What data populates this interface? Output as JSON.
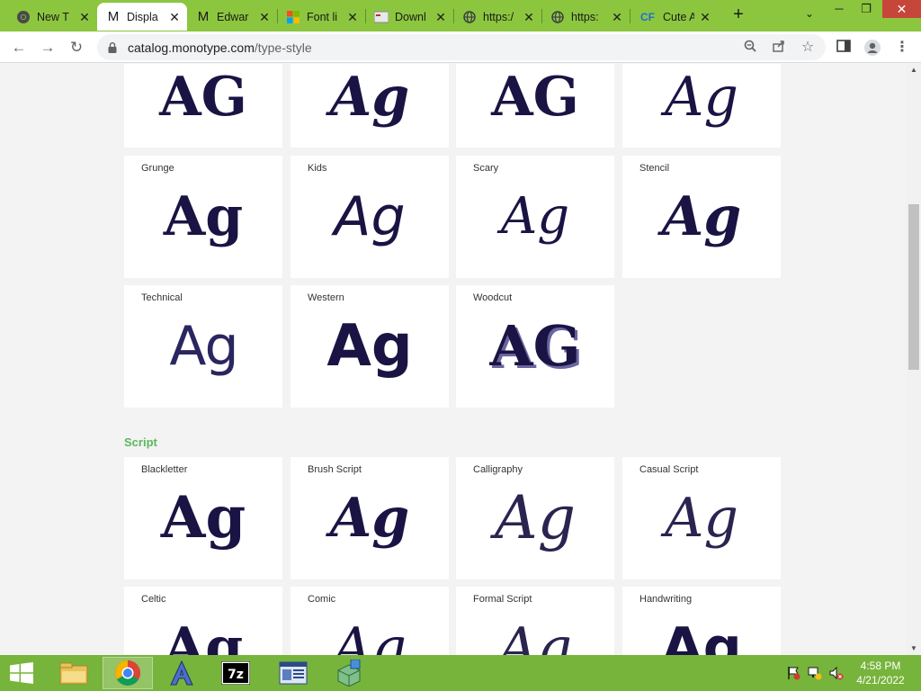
{
  "browser": {
    "tabs": [
      {
        "title": "New T",
        "icon": "chrome-icon",
        "active": false
      },
      {
        "title": "Displa",
        "icon": "monotype-m-icon",
        "active": true
      },
      {
        "title": "Edwar",
        "icon": "monotype-m-icon",
        "active": false
      },
      {
        "title": "Font li",
        "icon": "microsoft-icon",
        "active": false
      },
      {
        "title": "Downl",
        "icon": "download-site-icon",
        "active": false
      },
      {
        "title": "https:/",
        "icon": "globe-icon",
        "active": false
      },
      {
        "title": "https:",
        "icon": "globe-icon",
        "active": false
      },
      {
        "title": "Cute A",
        "icon": "cf-icon",
        "active": false
      }
    ],
    "new_tab_label": "+",
    "url_host": "catalog.monotype.com",
    "url_path": "/type-style"
  },
  "page": {
    "top_row": [
      {
        "sample": "AG"
      },
      {
        "sample": "Ag"
      },
      {
        "sample": "AG"
      },
      {
        "sample": "Ag"
      }
    ],
    "display_cards": [
      {
        "label": "Grunge",
        "sample": "Ag"
      },
      {
        "label": "Kids",
        "sample": "Ag"
      },
      {
        "label": "Scary",
        "sample": "Ag"
      },
      {
        "label": "Stencil",
        "sample": "Ag"
      },
      {
        "label": "Technical",
        "sample": "Ag"
      },
      {
        "label": "Western",
        "sample": "Ag"
      },
      {
        "label": "Woodcut",
        "sample": "AG"
      }
    ],
    "script_section_title": "Script",
    "script_cards": [
      {
        "label": "Blackletter",
        "sample": "Ag"
      },
      {
        "label": "Brush Script",
        "sample": "Ag"
      },
      {
        "label": "Calligraphy",
        "sample": "Ag"
      },
      {
        "label": "Casual Script",
        "sample": "Ag"
      },
      {
        "label": "Celtic",
        "sample": "Ag"
      },
      {
        "label": "Comic",
        "sample": "Ag"
      },
      {
        "label": "Formal Script",
        "sample": "Ag"
      },
      {
        "label": "Handwriting",
        "sample": "Ag"
      }
    ]
  },
  "taskbar": {
    "clock_time": "4:58 PM",
    "clock_date": "4/21/2022",
    "apps": [
      "start-icon",
      "file-explorer-icon",
      "chrome-icon",
      "font-app-icon",
      "7zip-icon",
      "document-viewer-icon",
      "package-installer-icon"
    ]
  },
  "colors": {
    "chrome_green": "#8cc63f",
    "taskbar_green": "#77b43b",
    "sample_ink": "#1a1444",
    "section_green": "#5bb85c"
  }
}
